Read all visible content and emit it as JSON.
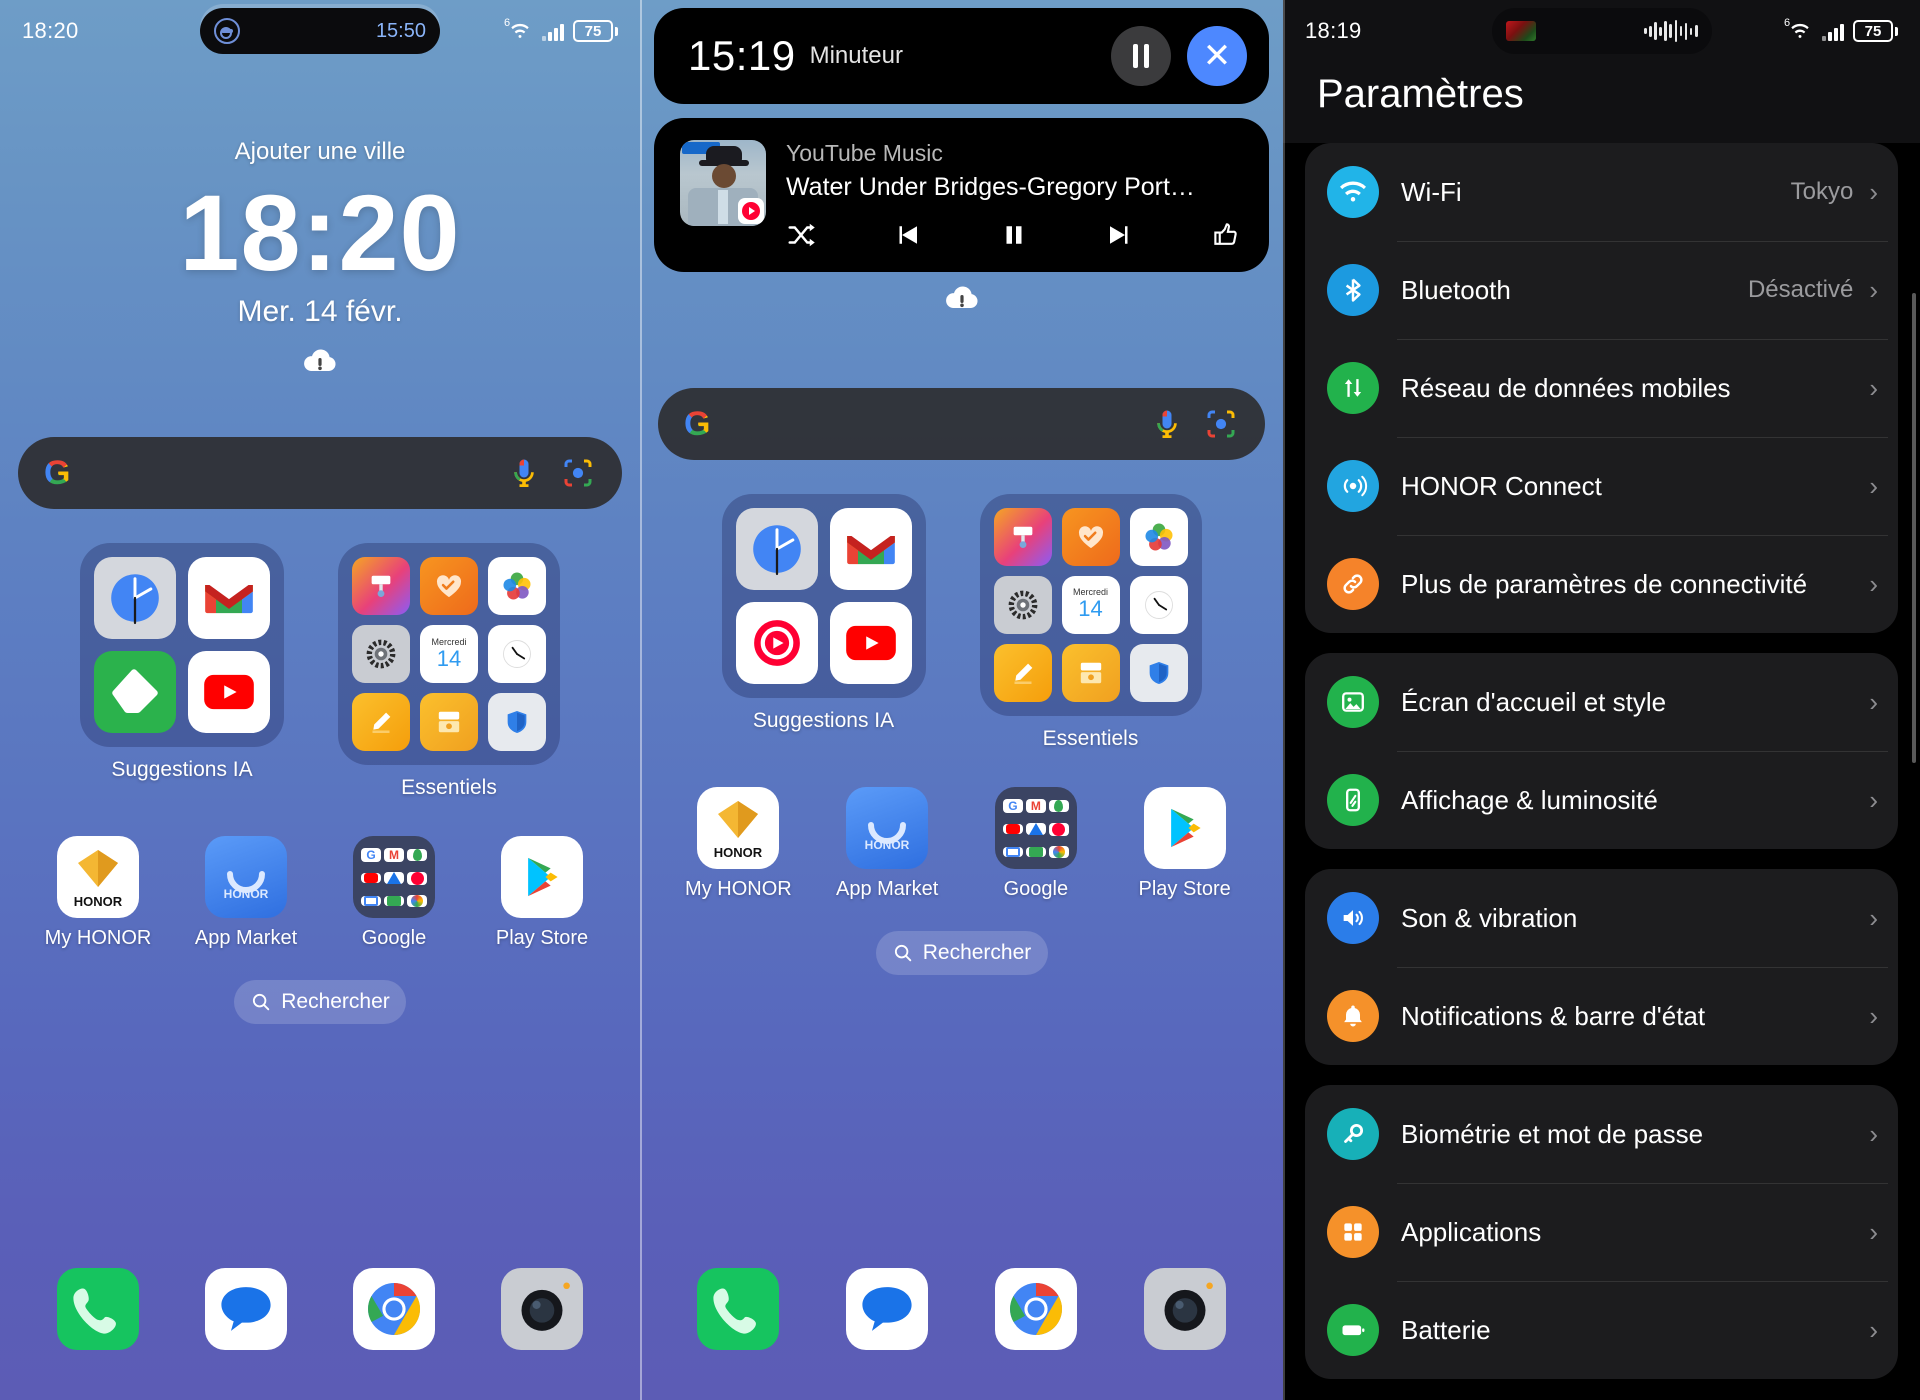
{
  "panel1": {
    "status": {
      "time": "18:20",
      "capsule_time": "15:50",
      "capsule_icon": "timer-icon",
      "wifi": "wifi-6-icon",
      "signal": "cellular-signal-icon",
      "battery": "75"
    },
    "lock": {
      "city": "Ajouter une ville",
      "time": "18:20",
      "date": "Mer. 14 févr.",
      "weather_icon": "cloud-exclamation-icon"
    },
    "search": {
      "logo": "google-g-icon",
      "mic": "microphone-icon",
      "lens": "google-lens-icon"
    },
    "folders": [
      {
        "label": "Suggestions IA",
        "icons": [
          "clock-icon",
          "gmail-icon",
          "feedly-icon",
          "youtube-icon"
        ]
      },
      {
        "label": "Essentiels",
        "icons": [
          "theme-brush-icon",
          "health-heart-icon",
          "gallery-icon",
          "system-settings-icon",
          "calendar-icon",
          "clock-analog-icon",
          "notes-icon",
          "files-icon",
          "security-shield-icon"
        ],
        "calendar_weekday": "Mercredi",
        "calendar_day": "14"
      }
    ],
    "apps": [
      {
        "label": "My HONOR",
        "icon": "honor-diamond-icon"
      },
      {
        "label": "App Market",
        "icon": "honor-appmarket-icon"
      },
      {
        "label": "Google",
        "icon": "google-folder-icon"
      },
      {
        "label": "Play Store",
        "icon": "play-store-icon"
      }
    ],
    "search_pill": {
      "label": "Rechercher",
      "icon": "search-icon"
    },
    "dock": [
      {
        "icon": "phone-icon"
      },
      {
        "icon": "messages-icon"
      },
      {
        "icon": "chrome-icon"
      },
      {
        "icon": "camera-icon"
      }
    ]
  },
  "panel2": {
    "timer_notif": {
      "time": "15:19",
      "label": "Minuteur",
      "pause_icon": "pause-icon",
      "close_icon": "close-icon"
    },
    "media_notif": {
      "app": "YouTube Music",
      "title": "Water Under Bridges-Gregory Port…",
      "album_art": "album-art-gregory-porter",
      "controls": [
        "shuffle-icon",
        "previous-track-icon",
        "pause-icon",
        "next-track-icon",
        "thumbs-up-icon"
      ]
    },
    "search": {
      "logo": "google-g-icon",
      "mic": "microphone-icon",
      "lens": "google-lens-icon"
    },
    "folders": [
      {
        "label": "Suggestions IA",
        "icons": [
          "clock-icon",
          "gmail-icon",
          "youtube-music-icon",
          "youtube-icon"
        ]
      },
      {
        "label": "Essentiels",
        "icons": [
          "theme-brush-icon",
          "health-heart-icon",
          "gallery-icon",
          "system-settings-icon",
          "calendar-icon",
          "clock-analog-icon",
          "notes-icon",
          "files-icon",
          "security-shield-icon"
        ],
        "calendar_weekday": "Mercredi",
        "calendar_day": "14"
      }
    ],
    "apps": [
      {
        "label": "My HONOR",
        "icon": "honor-diamond-icon"
      },
      {
        "label": "App Market",
        "icon": "honor-appmarket-icon"
      },
      {
        "label": "Google",
        "icon": "google-folder-icon"
      },
      {
        "label": "Play Store",
        "icon": "play-store-icon"
      }
    ],
    "search_pill": {
      "label": "Rechercher",
      "icon": "search-icon"
    },
    "dock": [
      {
        "icon": "phone-icon"
      },
      {
        "icon": "messages-icon"
      },
      {
        "icon": "chrome-icon"
      },
      {
        "icon": "camera-icon"
      }
    ]
  },
  "panel3": {
    "status": {
      "time": "18:19",
      "capsule_thumb": "media-thumbnail",
      "capsule_waveform": "audio-waveform-icon",
      "wifi": "wifi-6-icon",
      "signal": "cellular-signal-icon",
      "battery": "75"
    },
    "title": "Paramètres",
    "groups": [
      {
        "rows": [
          {
            "label": "Wi-Fi",
            "value": "Tokyo",
            "icon": "wifi-icon",
            "color": "#21b4e8"
          },
          {
            "label": "Bluetooth",
            "value": "Désactivé",
            "icon": "bluetooth-icon",
            "color": "#1c9ae0"
          },
          {
            "label": "Réseau de données mobiles",
            "value": "",
            "icon": "mobile-data-icon",
            "color": "#22b24c"
          },
          {
            "label": "HONOR Connect",
            "value": "",
            "icon": "honor-connect-icon",
            "color": "#22a5e0"
          },
          {
            "label": "Plus de paramètres de connectivité",
            "value": "",
            "icon": "link-icon",
            "color": "#f5832a"
          }
        ]
      },
      {
        "rows": [
          {
            "label": "Écran d'accueil et style",
            "value": "",
            "icon": "wallpaper-icon",
            "color": "#22b24c"
          },
          {
            "label": "Affichage & luminosité",
            "value": "",
            "icon": "display-brightness-icon",
            "color": "#22b24c"
          }
        ]
      },
      {
        "rows": [
          {
            "label": "Son & vibration",
            "value": "",
            "icon": "sound-icon",
            "color": "#2b7de9"
          },
          {
            "label": "Notifications & barre d'état",
            "value": "",
            "icon": "bell-icon",
            "color": "#f5912a"
          }
        ]
      },
      {
        "rows": [
          {
            "label": "Biométrie et mot de passe",
            "value": "",
            "icon": "key-icon",
            "color": "#17b0b8"
          },
          {
            "label": "Applications",
            "value": "",
            "icon": "apps-grid-icon",
            "color": "#f5912a"
          },
          {
            "label": "Batterie",
            "value": "",
            "icon": "battery-icon",
            "color": "#22b24c"
          }
        ]
      }
    ],
    "chevron": "chevron-right-icon"
  }
}
